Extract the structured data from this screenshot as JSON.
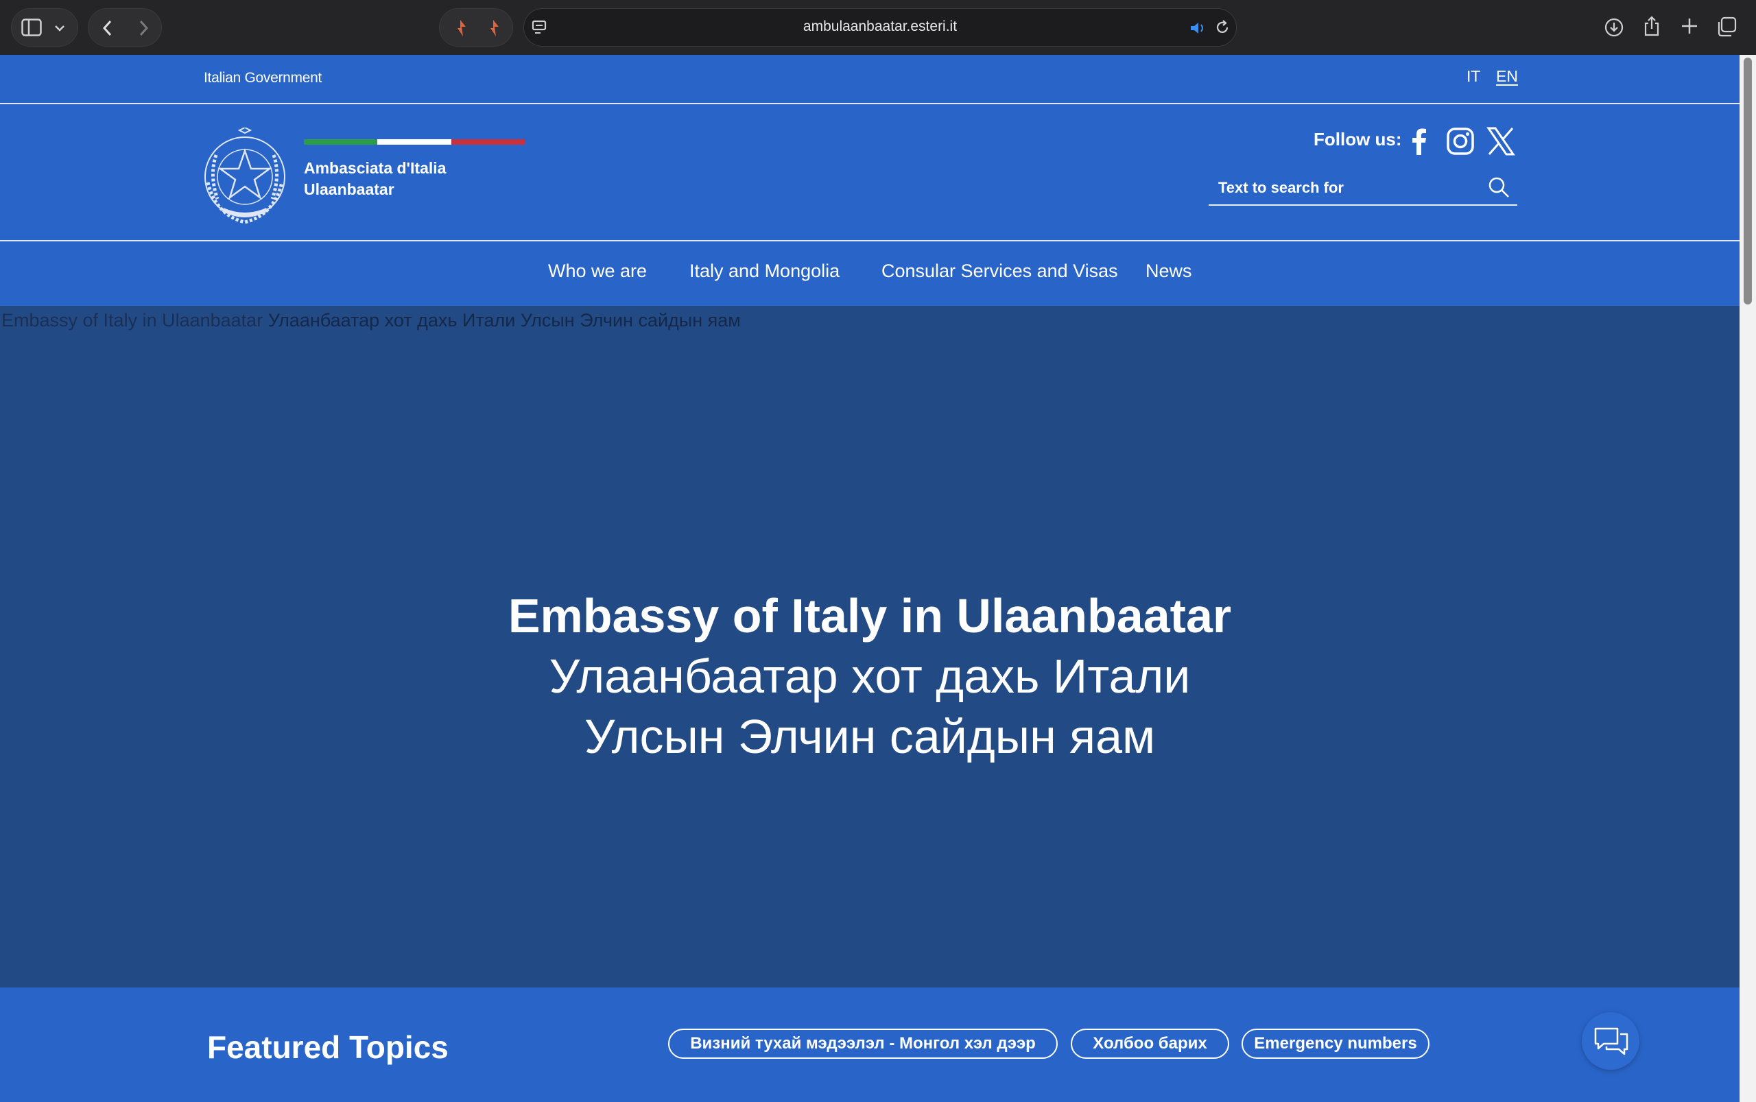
{
  "browser": {
    "url": "ambulaanbaatar.esteri.it"
  },
  "topbar": {
    "government_label": "Italian Government",
    "languages": [
      {
        "code": "IT",
        "active": false
      },
      {
        "code": "EN",
        "active": true
      }
    ]
  },
  "header": {
    "site_name_line1": "Ambasciata d'Italia",
    "site_name_line2": "Ulaanbaatar",
    "follow_label": "Follow us:",
    "social": [
      "facebook-icon",
      "instagram-icon",
      "x-icon"
    ],
    "search_placeholder": "Text to search for",
    "tricolor": [
      "#2e9c45",
      "#ffffff",
      "#c8313b"
    ]
  },
  "nav": {
    "items": [
      "Who we are",
      "Italy and Mongolia",
      "Consular Services and Visas",
      "News"
    ]
  },
  "hero": {
    "alt_text_en": "Embassy of Italy in Ulaanbaatar",
    "alt_text_mn": "Улаанбаатар хот дахь Итали Улсын Элчин сайдын яам",
    "title_line1": "Embassy of Italy in Ulaanbaatar",
    "title_line2": "Улаанбаатар хот дахь Итали",
    "title_line3": "Улсын Элчин сайдын яам"
  },
  "featured": {
    "title": "Featured Topics",
    "chips": [
      "Визний тухай мэдээлэл - Монгол хэл дээр",
      "Холбоо барих",
      "Emergency numbers"
    ]
  },
  "colors": {
    "primary": "#2965c9",
    "hero_bg": "#224a85"
  }
}
